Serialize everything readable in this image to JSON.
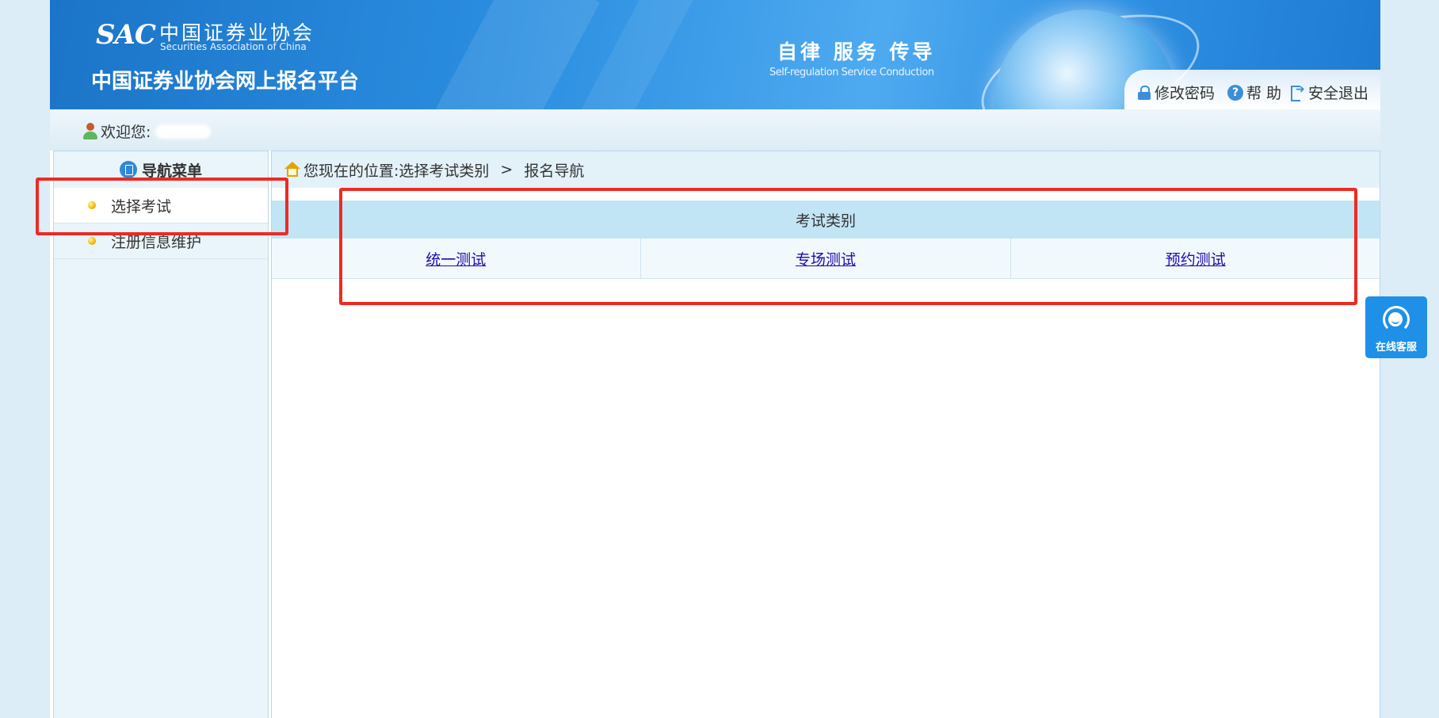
{
  "header": {
    "logo_mark": "SAC",
    "logo_cn": "中国证券业协会",
    "logo_en": "Securities Association of China",
    "site_title": "中国证券业协会网上报名平台",
    "slogan_cn": "自律 服务 传导",
    "slogan_en": "Self-regulation  Service  Conduction",
    "links": {
      "change_password": "修改密码",
      "help": "帮 助",
      "logout": "安全退出"
    }
  },
  "welcome": {
    "label": "欢迎您:"
  },
  "sidebar": {
    "title": "导航菜单",
    "items": [
      {
        "label": "选择考试"
      },
      {
        "label": "注册信息维护"
      }
    ]
  },
  "breadcrumb": {
    "prefix": "您现在的位置:",
    "level1": "选择考试类别",
    "separator": ">",
    "level2": "报名导航"
  },
  "exam_table": {
    "header": "考试类别",
    "links": [
      "统一测试",
      "专场测试",
      "预约测试"
    ]
  },
  "service": {
    "label": "在线客服"
  },
  "colors": {
    "annotation": "#ee2a24",
    "header_blue": "#2b8ee0",
    "link": "#1a0dab"
  }
}
